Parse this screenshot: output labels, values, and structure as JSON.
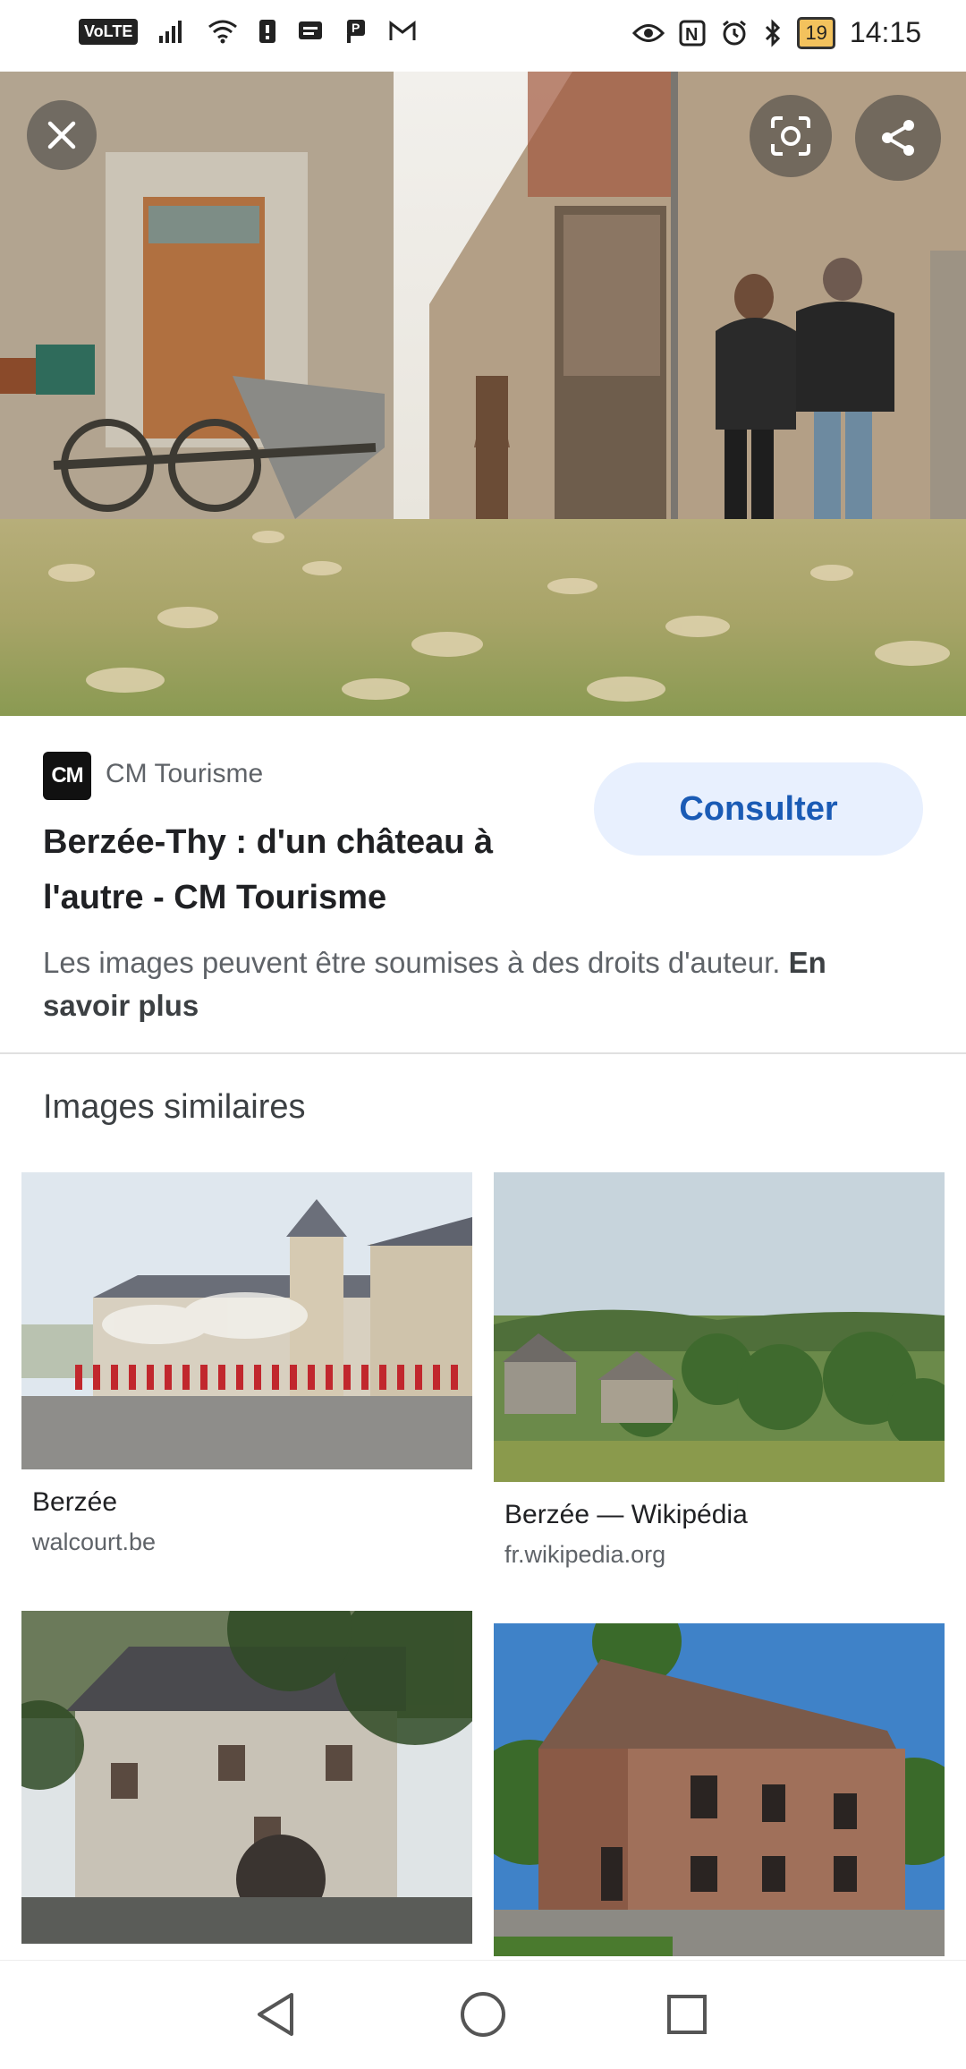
{
  "status_bar": {
    "left_icons": [
      "volte-icon",
      "signal-icon",
      "wifi-icon",
      "sim-icon",
      "message-icon",
      "parking-icon",
      "gmail-icon"
    ],
    "volte_label": "VoLTE",
    "right_icons": [
      "eye-icon",
      "nfc-icon",
      "alarm-icon",
      "bluetooth-icon"
    ],
    "battery": "19",
    "time": "14:15"
  },
  "hero": {
    "close_icon": "close-icon",
    "lens_icon": "lens-icon",
    "share_icon": "share-icon"
  },
  "source": {
    "logo": "CM",
    "name": "CM Tourisme"
  },
  "result": {
    "title": "Berzée-Thy : d'un château à l'autre - CM Tourisme",
    "consult_label": "Consulter",
    "copyright_text": "Les images peuvent être soumises à des droits d'auteur.",
    "learn_more": "En savoir plus"
  },
  "similar": {
    "heading": "Images similaires",
    "items": [
      {
        "title": "Berzée",
        "source": "walcourt.be"
      },
      {
        "title": "Berzée — Wikipédia",
        "source": "fr.wikipedia.org"
      }
    ]
  },
  "nav": {
    "back_icon": "back-triangle-icon",
    "home_icon": "home-circle-icon",
    "recents_icon": "recents-square-icon"
  }
}
